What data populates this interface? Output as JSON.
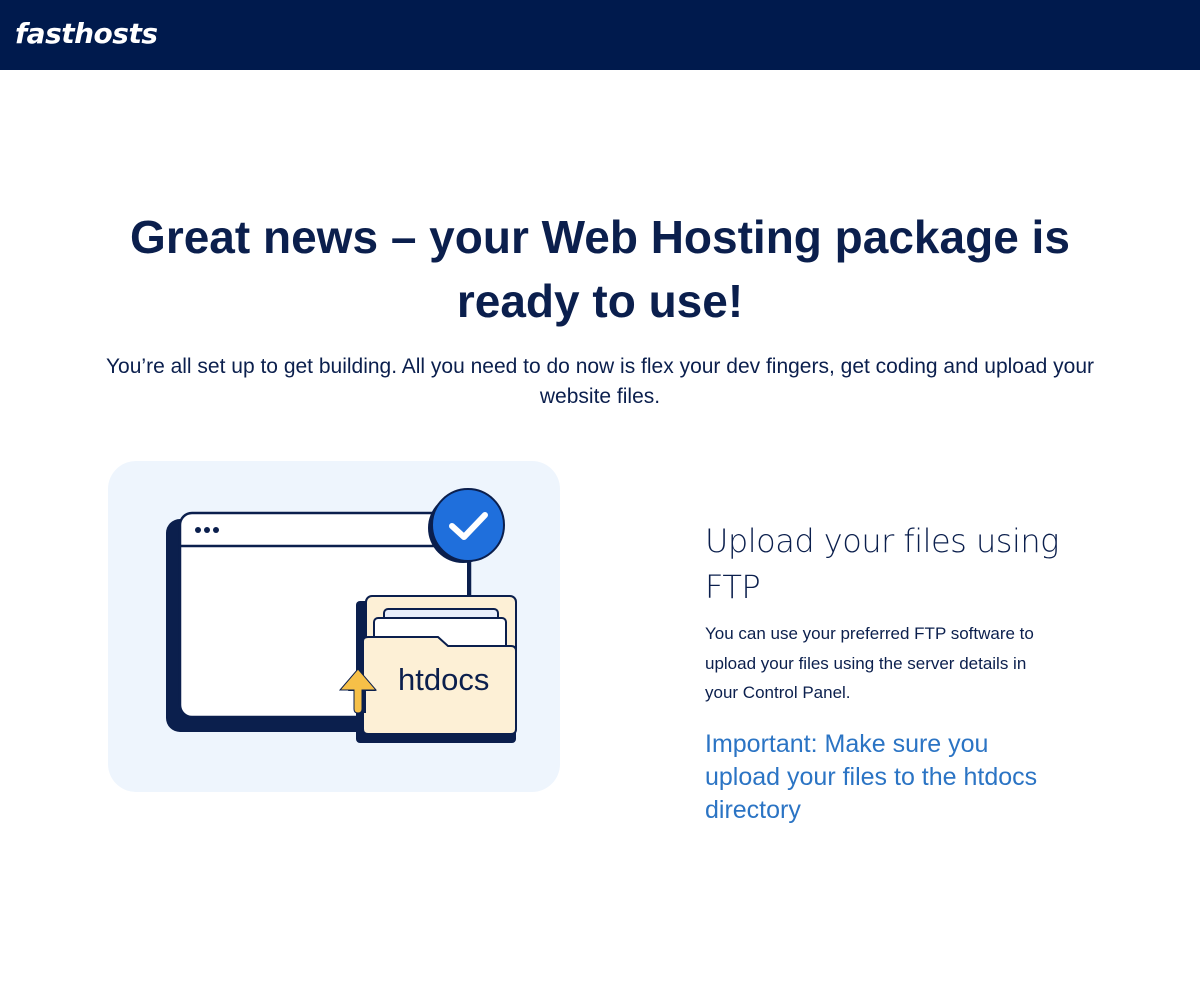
{
  "header": {
    "logo_text": "fasthosts",
    "background_color": "#001a4d"
  },
  "hero": {
    "headline": "Great news – your Web Hosting package is ready to use!",
    "subline": "You’re all set up to get building. All you need to do now is flex your dev fingers, get coding and upload your website files."
  },
  "illustration": {
    "folder_label": "htdocs",
    "icons": [
      "browser-window-icon",
      "check-circle-icon",
      "folder-icon",
      "upload-arrow-icon"
    ],
    "panel_color": "#eef5fd",
    "check_color": "#1f6fdc",
    "arrow_color": "#f6c048"
  },
  "ftp_section": {
    "title": "Upload your files using FTP",
    "body": "You can use your preferred FTP software to upload your files using the server details in your Control Panel.",
    "important": "Important: Make sure you upload your files to the htdocs directory",
    "important_color": "#2b74c4"
  }
}
